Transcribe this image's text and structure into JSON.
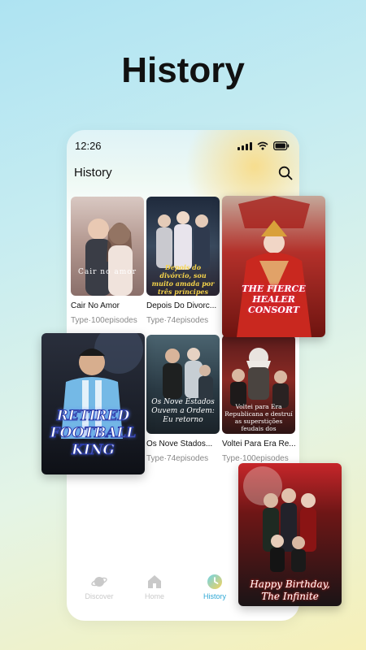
{
  "headline": "History",
  "status": {
    "time": "12:26"
  },
  "screen_title": "History",
  "cards": [
    {
      "name": "Cair No Amor",
      "type": "Type·100episodes",
      "poster_text": "Cair no amor"
    },
    {
      "name": "Depois Do Divorc...",
      "type": "Type·74episodes",
      "poster_text": "Depois do divórcio, sou muito amada por três príncipes"
    },
    {
      "name": "Os Nove Stados...",
      "type": "Type·74episodes",
      "poster_text": "Os Nove Estados Ouvem a Ordem: Eu retorno"
    },
    {
      "name": "Voltei Para Era Re...",
      "type": "Type·100episodes",
      "poster_text": "Voltei para Era Republicana e destruí as superstições feudais dos"
    }
  ],
  "featured": [
    {
      "poster_text": "THE FIERCE HEALER CONSORT"
    },
    {
      "poster_text": "RETIRED FOOTBALL KING"
    },
    {
      "poster_text": "Happy Birthday, The Infinite"
    }
  ],
  "tabs": [
    {
      "label": "Discover",
      "active": false
    },
    {
      "label": "Home",
      "active": false
    },
    {
      "label": "History",
      "active": true
    }
  ],
  "colors": {
    "active_tab": "#2fa8d5",
    "inactive_tab": "#c9c9c9"
  }
}
